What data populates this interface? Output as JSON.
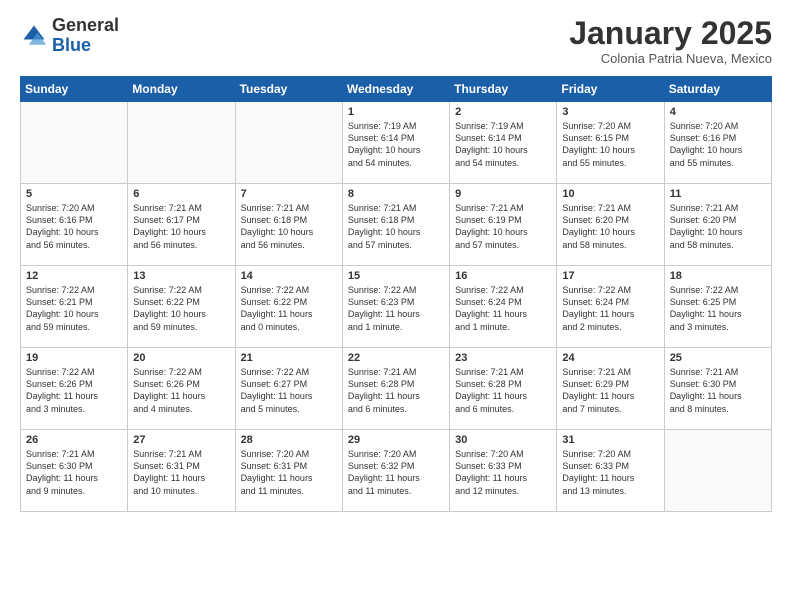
{
  "logo": {
    "general": "General",
    "blue": "Blue"
  },
  "header": {
    "month": "January 2025",
    "location": "Colonia Patria Nueva, Mexico"
  },
  "days_of_week": [
    "Sunday",
    "Monday",
    "Tuesday",
    "Wednesday",
    "Thursday",
    "Friday",
    "Saturday"
  ],
  "weeks": [
    [
      {
        "day": "",
        "info": ""
      },
      {
        "day": "",
        "info": ""
      },
      {
        "day": "",
        "info": ""
      },
      {
        "day": "1",
        "info": "Sunrise: 7:19 AM\nSunset: 6:14 PM\nDaylight: 10 hours\nand 54 minutes."
      },
      {
        "day": "2",
        "info": "Sunrise: 7:19 AM\nSunset: 6:14 PM\nDaylight: 10 hours\nand 54 minutes."
      },
      {
        "day": "3",
        "info": "Sunrise: 7:20 AM\nSunset: 6:15 PM\nDaylight: 10 hours\nand 55 minutes."
      },
      {
        "day": "4",
        "info": "Sunrise: 7:20 AM\nSunset: 6:16 PM\nDaylight: 10 hours\nand 55 minutes."
      }
    ],
    [
      {
        "day": "5",
        "info": "Sunrise: 7:20 AM\nSunset: 6:16 PM\nDaylight: 10 hours\nand 56 minutes."
      },
      {
        "day": "6",
        "info": "Sunrise: 7:21 AM\nSunset: 6:17 PM\nDaylight: 10 hours\nand 56 minutes."
      },
      {
        "day": "7",
        "info": "Sunrise: 7:21 AM\nSunset: 6:18 PM\nDaylight: 10 hours\nand 56 minutes."
      },
      {
        "day": "8",
        "info": "Sunrise: 7:21 AM\nSunset: 6:18 PM\nDaylight: 10 hours\nand 57 minutes."
      },
      {
        "day": "9",
        "info": "Sunrise: 7:21 AM\nSunset: 6:19 PM\nDaylight: 10 hours\nand 57 minutes."
      },
      {
        "day": "10",
        "info": "Sunrise: 7:21 AM\nSunset: 6:20 PM\nDaylight: 10 hours\nand 58 minutes."
      },
      {
        "day": "11",
        "info": "Sunrise: 7:21 AM\nSunset: 6:20 PM\nDaylight: 10 hours\nand 58 minutes."
      }
    ],
    [
      {
        "day": "12",
        "info": "Sunrise: 7:22 AM\nSunset: 6:21 PM\nDaylight: 10 hours\nand 59 minutes."
      },
      {
        "day": "13",
        "info": "Sunrise: 7:22 AM\nSunset: 6:22 PM\nDaylight: 10 hours\nand 59 minutes."
      },
      {
        "day": "14",
        "info": "Sunrise: 7:22 AM\nSunset: 6:22 PM\nDaylight: 11 hours\nand 0 minutes."
      },
      {
        "day": "15",
        "info": "Sunrise: 7:22 AM\nSunset: 6:23 PM\nDaylight: 11 hours\nand 1 minute."
      },
      {
        "day": "16",
        "info": "Sunrise: 7:22 AM\nSunset: 6:24 PM\nDaylight: 11 hours\nand 1 minute."
      },
      {
        "day": "17",
        "info": "Sunrise: 7:22 AM\nSunset: 6:24 PM\nDaylight: 11 hours\nand 2 minutes."
      },
      {
        "day": "18",
        "info": "Sunrise: 7:22 AM\nSunset: 6:25 PM\nDaylight: 11 hours\nand 3 minutes."
      }
    ],
    [
      {
        "day": "19",
        "info": "Sunrise: 7:22 AM\nSunset: 6:26 PM\nDaylight: 11 hours\nand 3 minutes."
      },
      {
        "day": "20",
        "info": "Sunrise: 7:22 AM\nSunset: 6:26 PM\nDaylight: 11 hours\nand 4 minutes."
      },
      {
        "day": "21",
        "info": "Sunrise: 7:22 AM\nSunset: 6:27 PM\nDaylight: 11 hours\nand 5 minutes."
      },
      {
        "day": "22",
        "info": "Sunrise: 7:21 AM\nSunset: 6:28 PM\nDaylight: 11 hours\nand 6 minutes."
      },
      {
        "day": "23",
        "info": "Sunrise: 7:21 AM\nSunset: 6:28 PM\nDaylight: 11 hours\nand 6 minutes."
      },
      {
        "day": "24",
        "info": "Sunrise: 7:21 AM\nSunset: 6:29 PM\nDaylight: 11 hours\nand 7 minutes."
      },
      {
        "day": "25",
        "info": "Sunrise: 7:21 AM\nSunset: 6:30 PM\nDaylight: 11 hours\nand 8 minutes."
      }
    ],
    [
      {
        "day": "26",
        "info": "Sunrise: 7:21 AM\nSunset: 6:30 PM\nDaylight: 11 hours\nand 9 minutes."
      },
      {
        "day": "27",
        "info": "Sunrise: 7:21 AM\nSunset: 6:31 PM\nDaylight: 11 hours\nand 10 minutes."
      },
      {
        "day": "28",
        "info": "Sunrise: 7:20 AM\nSunset: 6:31 PM\nDaylight: 11 hours\nand 11 minutes."
      },
      {
        "day": "29",
        "info": "Sunrise: 7:20 AM\nSunset: 6:32 PM\nDaylight: 11 hours\nand 11 minutes."
      },
      {
        "day": "30",
        "info": "Sunrise: 7:20 AM\nSunset: 6:33 PM\nDaylight: 11 hours\nand 12 minutes."
      },
      {
        "day": "31",
        "info": "Sunrise: 7:20 AM\nSunset: 6:33 PM\nDaylight: 11 hours\nand 13 minutes."
      },
      {
        "day": "",
        "info": ""
      }
    ]
  ]
}
